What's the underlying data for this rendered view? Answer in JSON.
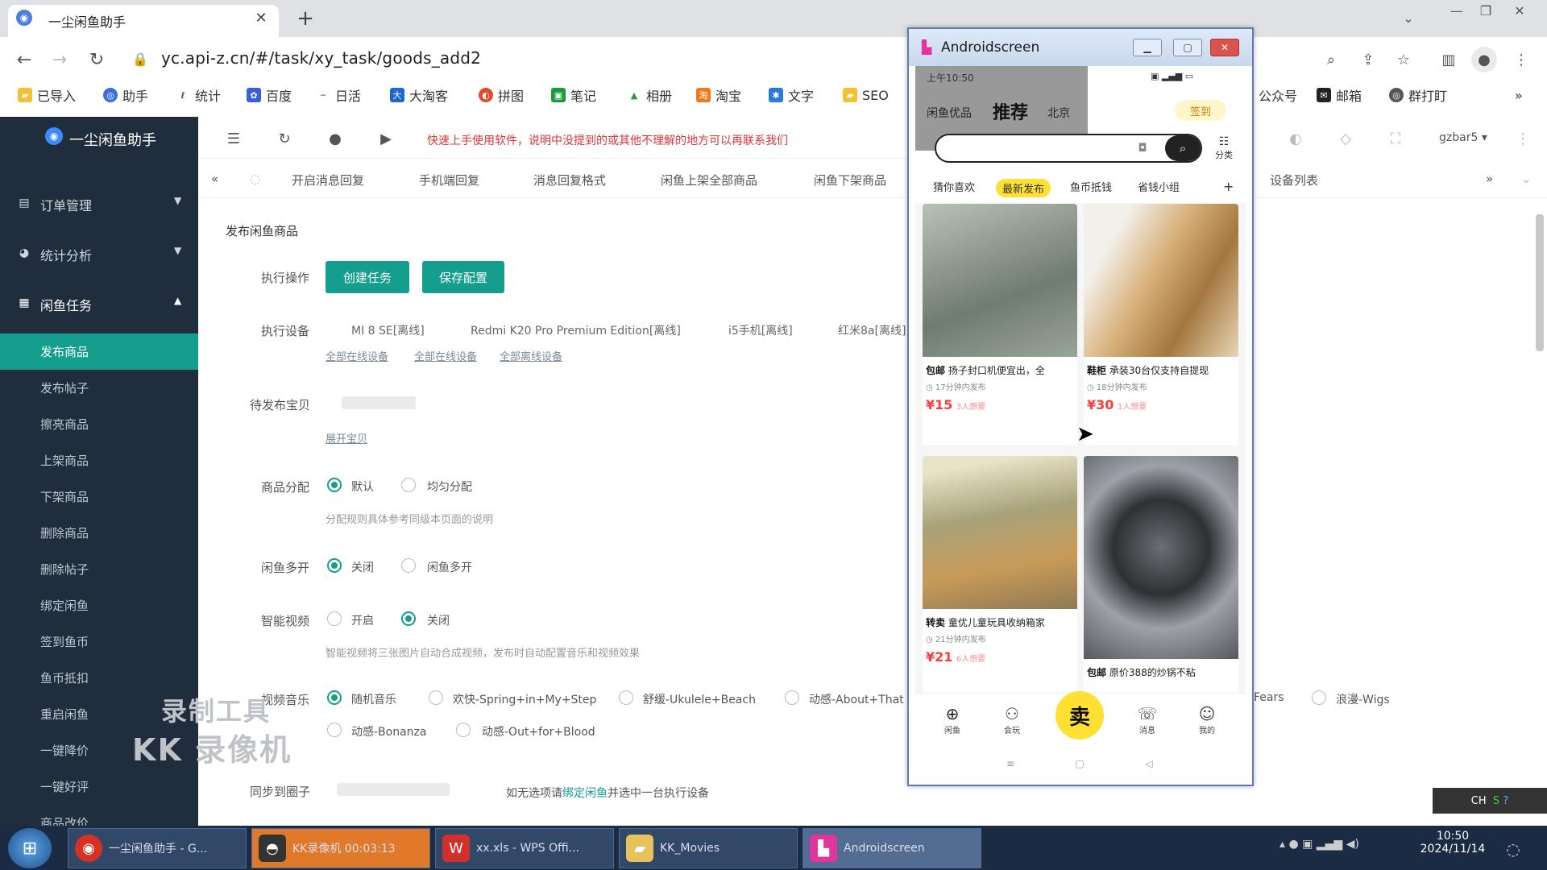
{
  "browser": {
    "tab_title": "一尘闲鱼助手",
    "url": "yc.api-z.cn/#/task/xy_task/goods_add2",
    "bookmarks": [
      "已导入",
      "助手",
      "统计",
      "百度",
      "日活",
      "大淘客",
      "拼图",
      "笔记",
      "相册",
      "淘宝",
      "文字",
      "SEO",
      "公众号",
      "邮箱",
      "群打盯"
    ]
  },
  "app": {
    "logo_text": "一尘闲鱼助手",
    "menu": [
      {
        "label": "订单管理",
        "arrow": "▼"
      },
      {
        "label": "统计分析",
        "arrow": "▼"
      },
      {
        "label": "闲鱼任务",
        "arrow": "▲"
      }
    ],
    "submenu": [
      "发布商品",
      "发布帖子",
      "擦亮商品",
      "上架商品",
      "下架商品",
      "删除商品",
      "删除帖子",
      "绑定闲鱼",
      "签到鱼币",
      "鱼币抵扣",
      "重启闲鱼",
      "一键降价",
      "一键好评",
      "商品改价"
    ],
    "notice": "快速上手使用软件，说明中没提到的或其他不理解的地方可以再联系我们",
    "tabs": [
      "开启消息回复",
      "手机端回复",
      "消息回复格式",
      "闲鱼上架全部商品",
      "闲鱼下架商品",
      "设备列表"
    ],
    "user": "gzbar5 ▾",
    "section_title": "发布闲鱼商品",
    "form": {
      "action_label": "执行操作",
      "create_btn": "创建任务",
      "save_btn": "保存配置",
      "device_label": "执行设备",
      "devices": [
        "MI 8 SE[离线]",
        "Redmi K20 Pro Premium Edition[离线]",
        "i5手机[离线]",
        "红米8a[离线]"
      ],
      "device_links": [
        "全部在线设备",
        "全部在线设备",
        "全部离线设备"
      ],
      "pending_label": "待发布宝贝",
      "pending_link": "展开宝贝",
      "dist_label": "商品分配",
      "dist_opts": [
        "默认",
        "均匀分配"
      ],
      "dist_hint": "分配规则具体参考同级本页面的说明",
      "multi_label": "闲鱼多开",
      "multi_opts": [
        "关闭",
        "闲鱼多开"
      ],
      "video_label": "智能视频",
      "video_opts": [
        "开启",
        "关闭"
      ],
      "video_hint": "智能视频将三张图片自动合成视频，发布时自动配置音乐和视频效果",
      "music_label": "视频音乐",
      "music_opts": [
        "随机音乐",
        "欢快-Spring+in+My+Step",
        "舒缓-Ukulele+Beach",
        "动感-About+That",
        "Fears",
        "浪漫-Wigs",
        "动感-Bonanza",
        "动感-Out+for+Blood"
      ],
      "sync_label": "同步到圈子",
      "sync_hint_a": "如无选项请",
      "sync_hint_link": "绑定闲鱼",
      "sync_hint_b": "并选中一台执行设备"
    },
    "watermark": [
      "录制工具",
      "KK 录像机"
    ]
  },
  "android": {
    "title": "Androidscreen",
    "status_time": "上午10:50",
    "nav": [
      "闲鱼优品",
      "推荐",
      "北京"
    ],
    "sign": "签到",
    "category_label": "分类",
    "tabs": [
      "猜你喜欢",
      "最新发布",
      "鱼币抵钱",
      "省钱小组",
      "+"
    ],
    "cards": [
      {
        "badge": "包邮",
        "title": "扬子封口机便宜出，全",
        "meta": "17分钟内发布",
        "price": "¥15",
        "sub": "3人想要",
        "img_color": "#8f9a8c"
      },
      {
        "badge": "鞋柜",
        "title": "承装30台仅支持自提现",
        "meta": "18分钟内发布",
        "price": "¥30",
        "sub": "1人想要",
        "img_color": "#c39a6a"
      },
      {
        "badge": "转卖",
        "title": "童优儿童玩具收纳箱家",
        "meta": "21分钟内发布",
        "price": "¥21",
        "sub": "6人想要",
        "img_color": "#a8a27a"
      },
      {
        "badge": "包邮",
        "title": "原价388的炒锅不粘",
        "meta": "",
        "price": "",
        "sub": "",
        "img_color": "#4a4d52"
      }
    ],
    "bottom": [
      "闲鱼",
      "会玩",
      "卖",
      "消息",
      "我的"
    ]
  },
  "taskbar": {
    "items": [
      "一尘闲鱼助手 - G...",
      "KK录像机 00:03:13",
      "xx.xls - WPS Offi...",
      "KK_Movies",
      "Androidscreen"
    ],
    "time": "10:50",
    "date": "2024/11/14",
    "ime": "CH"
  }
}
